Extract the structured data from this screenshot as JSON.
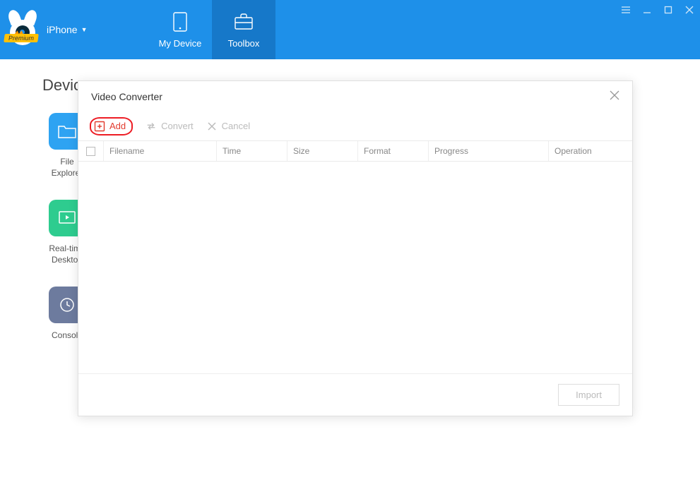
{
  "header": {
    "device_label": "iPhone",
    "premium_label": "Premium",
    "tabs": [
      {
        "label": "My Device"
      },
      {
        "label": "Toolbox"
      }
    ]
  },
  "bg": {
    "heading": "Device",
    "tiles": [
      {
        "line1": "File",
        "line2": "Explorer"
      },
      {
        "line1": "Real-time",
        "line2": "Desktop"
      },
      {
        "line1": "Console",
        "line2": ""
      }
    ]
  },
  "modal": {
    "title": "Video Converter",
    "toolbar": {
      "add_label": "Add",
      "convert_label": "Convert",
      "cancel_label": "Cancel"
    },
    "columns": {
      "filename": "Filename",
      "time": "Time",
      "size": "Size",
      "format": "Format",
      "progress": "Progress",
      "operation": "Operation"
    },
    "footer": {
      "import_label": "Import"
    }
  }
}
